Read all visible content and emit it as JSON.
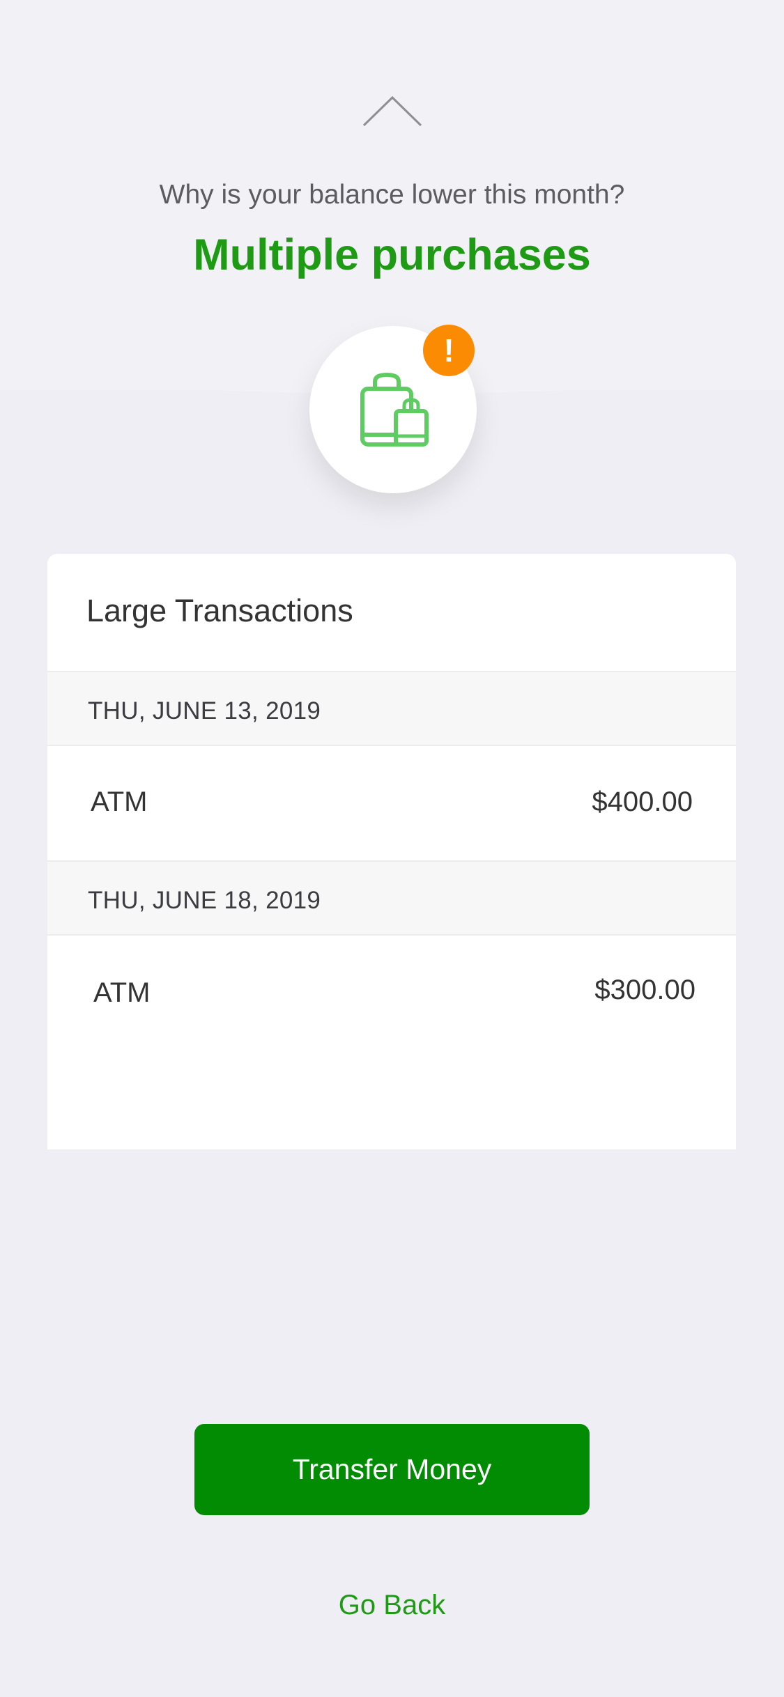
{
  "header": {
    "question": "Why is your balance lower this month?",
    "headline": "Multiple purchases",
    "alert_symbol": "!",
    "icons": {
      "collapse": "chevron-up-icon",
      "shopping": "shopping-bags-icon",
      "alert": "exclamation-icon"
    }
  },
  "card": {
    "title": "Large Transactions",
    "groups": [
      {
        "date": "THU, JUNE 13, 2019",
        "transactions": [
          {
            "label": "ATM",
            "amount": "$400.00"
          }
        ]
      },
      {
        "date": "THU, JUNE 18, 2019",
        "transactions": [
          {
            "label": "ATM",
            "amount": "$300.00"
          }
        ]
      }
    ]
  },
  "actions": {
    "primary_label": "Transfer Money",
    "secondary_label": "Go Back"
  },
  "colors": {
    "brand_green": "#1E9A14",
    "button_green": "#028C03",
    "alert_orange": "#FB8B03",
    "icon_green": "#5FCB63",
    "background": "#EEEEF4"
  }
}
